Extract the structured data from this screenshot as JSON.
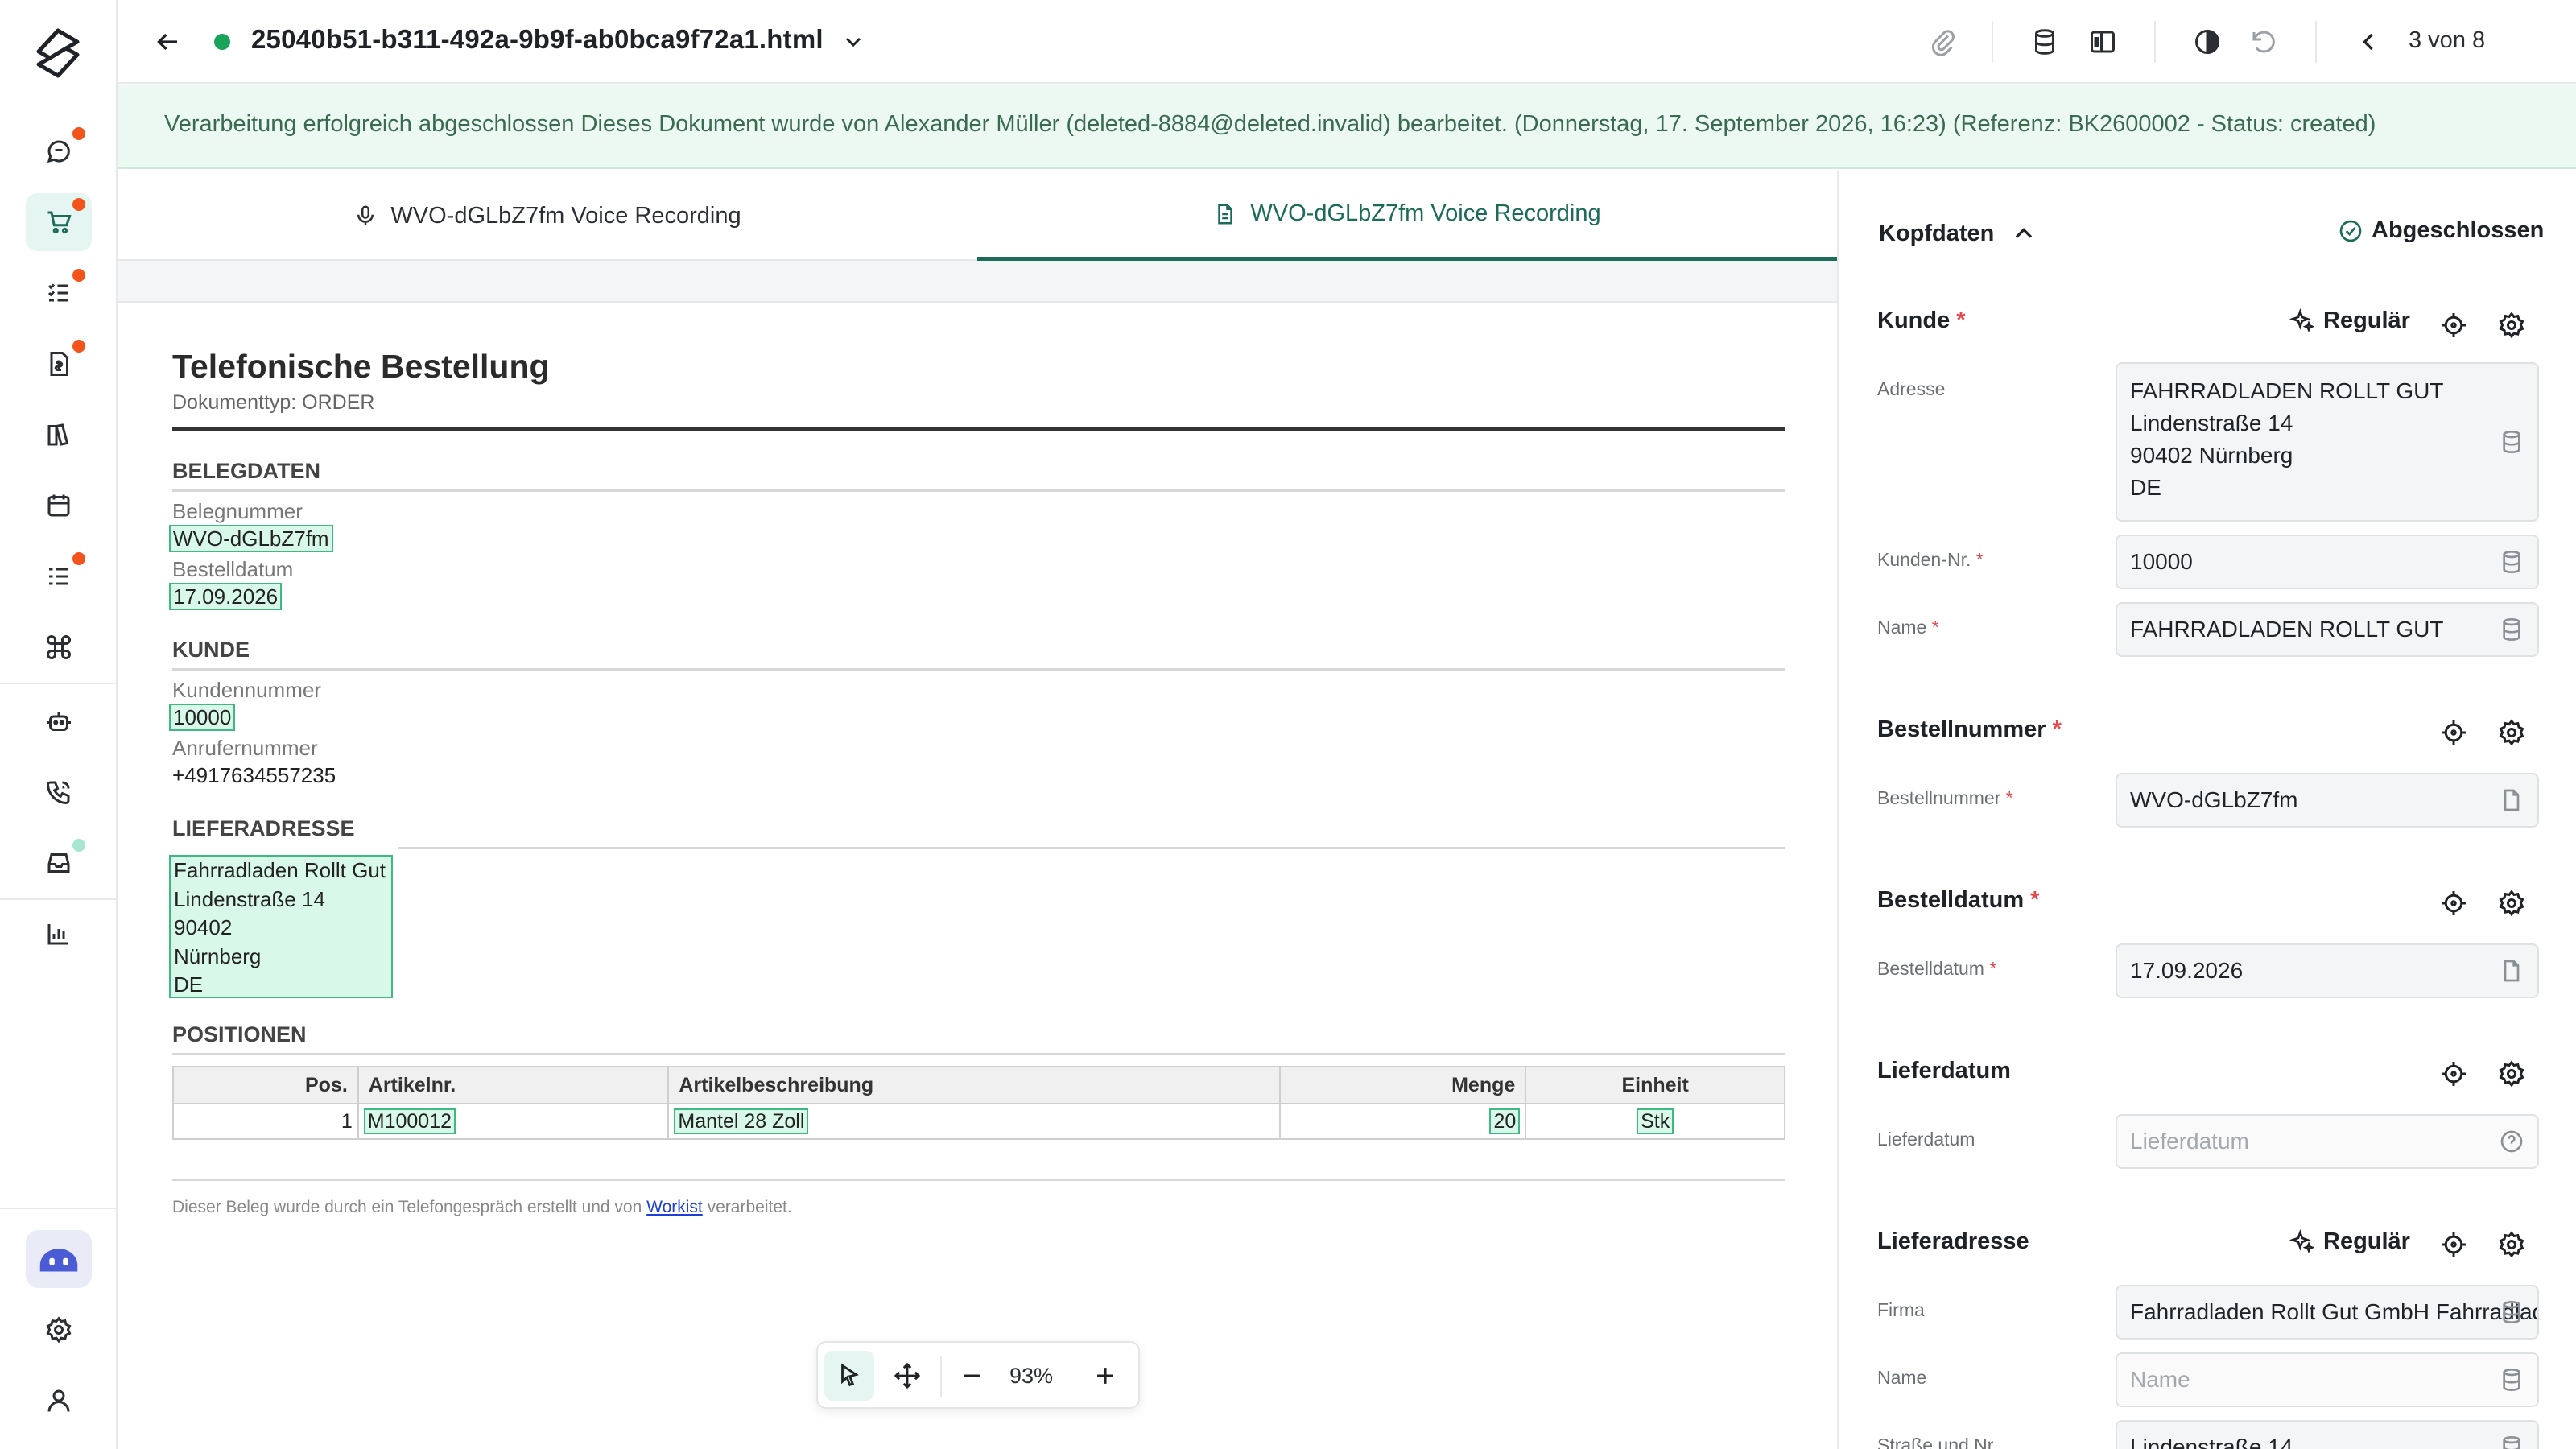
{
  "topbar": {
    "title": "25040b51-b311-492a-9b9f-ab0bca9f72a1.html",
    "page_indicator": "3 von 8",
    "status_color": "#1aa35a"
  },
  "banner": {
    "message": "Verarbeitung erfolgreich abgeschlossen Dieses Dokument wurde von Alexander Müller (deleted-8884@deleted.invalid) bearbeitet. (Donnerstag, 17. September 2026, 16:23) (Referenz: BK2600002 - Status: created)"
  },
  "tabs": [
    {
      "label": "WVO-dGLbZ7fm Voice Recording",
      "icon": "microphone-icon"
    },
    {
      "label": "WVO-dGLbZ7fm Voice Recording",
      "icon": "document-icon"
    }
  ],
  "document": {
    "title": "Telefonische Bestellung",
    "doctype": "Dokumenttyp: ORDER",
    "sections": {
      "belegdaten": "BELEGDATEN",
      "kunde": "KUNDE",
      "lieferadresse": "LIEFERADRESSE",
      "positionen": "POSITIONEN"
    },
    "belegnummer_label": "Belegnummer",
    "belegnummer": "WVO-dGLbZ7fm",
    "bestelldatum_label": "Bestelldatum",
    "bestelldatum": "17.09.2026",
    "kundennummer_label": "Kundennummer",
    "kundennummer": "10000",
    "anrufernummer_label": "Anrufernummer",
    "anrufernummer": "+4917634557235",
    "address": [
      "Fahrradladen Rollt Gut",
      "Lindenstraße 14",
      "90402",
      "Nürnberg",
      "DE"
    ],
    "table": {
      "headers": [
        "Pos.",
        "Artikelnr.",
        "Artikelbeschreibung",
        "Menge",
        "Einheit"
      ],
      "rows": [
        {
          "pos": "1",
          "artikelnr": "M100012",
          "beschreibung": "Mantel 28 Zoll",
          "menge": "20",
          "einheit": "Stk"
        }
      ]
    },
    "footer_pre": "Dieser Beleg wurde durch ein Telefongespräch erstellt und von",
    "footer_link": "Workist",
    "footer_post": "verarbeitet."
  },
  "zoom": {
    "value": "93%"
  },
  "panel": {
    "header": "Kopfdaten",
    "status": "Abgeschlossen",
    "regular_label": "Regulär",
    "kunde": {
      "title": "Kunde",
      "adresse_label": "Adresse",
      "adresse": [
        "FAHRRADLADEN ROLLT GUT",
        "Lindenstraße 14",
        "90402 Nürnberg",
        "DE"
      ],
      "kundennr_label": "Kunden-Nr.",
      "kundennr": "10000",
      "name_label": "Name",
      "name": "FAHRRADLADEN ROLLT GUT"
    },
    "bestellnummer": {
      "title": "Bestellnummer",
      "label": "Bestellnummer",
      "value": "WVO-dGLbZ7fm"
    },
    "bestelldatum": {
      "title": "Bestelldatum",
      "label": "Bestelldatum",
      "value": "17.09.2026"
    },
    "lieferdatum": {
      "title": "Lieferdatum",
      "label": "Lieferdatum",
      "placeholder": "Lieferdatum"
    },
    "lieferadresse": {
      "title": "Lieferadresse",
      "firma_label": "Firma",
      "firma": "Fahrradladen Rollt Gut GmbH Fahrradladen Rollt Gut",
      "name_label": "Name",
      "name_placeholder": "Name",
      "strasse_label": "Straße und Nr.",
      "strasse": "Lindenstraße 14"
    }
  },
  "colors": {
    "accent": "#1b6b58",
    "highlight": "#d8f8ea",
    "notification": "#f2541b"
  }
}
